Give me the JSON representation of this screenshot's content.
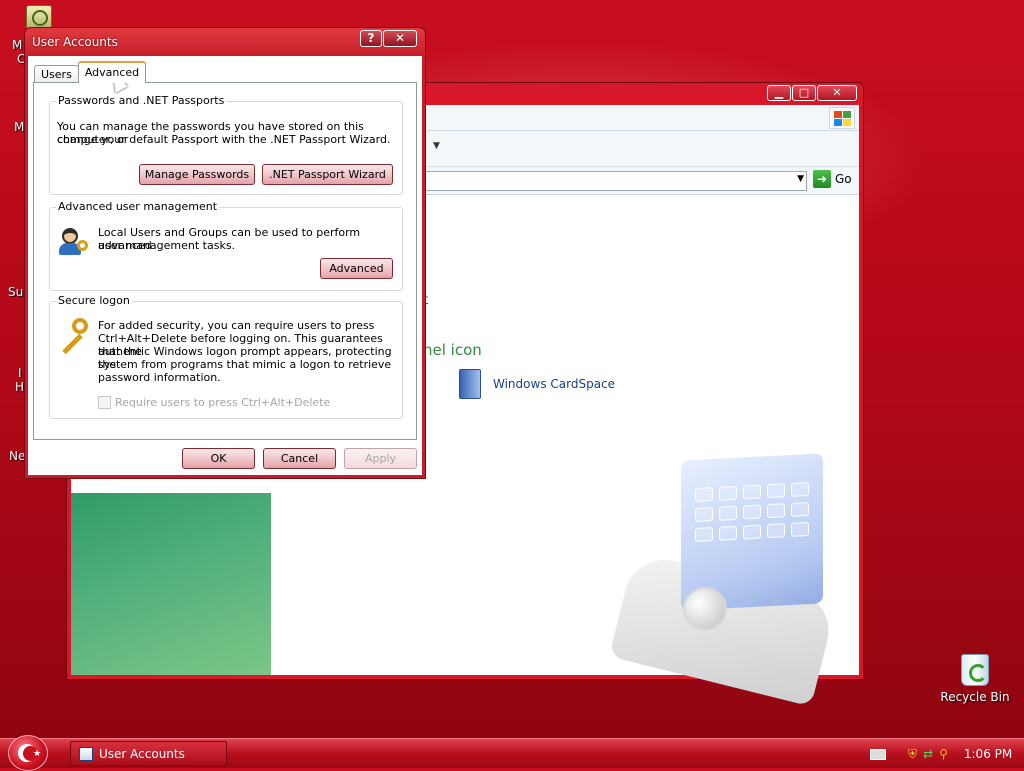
{
  "dialog": {
    "title": "User Accounts",
    "help_glyph": "?",
    "close_glyph": "✕",
    "tabs": [
      {
        "label": "Users",
        "active": false
      },
      {
        "label": "Advanced",
        "active": true
      }
    ],
    "passwords": {
      "title": "Passwords and .NET Passports",
      "text_line1": "You can manage the passwords you have stored on this computer, or",
      "text_line2": "change your default Passport with the .NET Passport Wizard.",
      "manage_button": "Manage Passwords",
      "wizard_button": ".NET Passport Wizard"
    },
    "advanced_management": {
      "title": "Advanced user management",
      "text_line1": "Local Users and Groups can be used to perform advanced",
      "text_line2": "user management tasks.",
      "button": "Advanced"
    },
    "secure_logon": {
      "title": "Secure logon",
      "text_line1": "For added security, you can require users to press",
      "text_line2": "Ctrl+Alt+Delete before logging on. This guarantees that the",
      "text_line3": "authentic Windows logon prompt appears, protecting the",
      "text_line4": "system from programs that mimic a logon to retrieve",
      "text_line5": "password information.",
      "checkbox_label": "Require users to press Ctrl+Alt+Delete",
      "checkbox_checked": false
    },
    "ok_button": "OK",
    "cancel_button": "Cancel",
    "apply_button": "Apply"
  },
  "background_window": {
    "minimize_glyph": "▁",
    "maximize_glyph": "□",
    "close_glyph": "✕",
    "go_label": "Go",
    "go_arrow": "➜",
    "text_fragment_1": "t",
    "text_fragment_2": "nel icon",
    "cardspace_label": "Windows CardSpace"
  },
  "desktop": {
    "fragments": [
      "M",
      "C",
      "M",
      "Su",
      "I",
      "H",
      "Ne"
    ],
    "recycle_bin_label": "Recycle Bin"
  },
  "taskbar": {
    "task_label": "User Accounts",
    "clock": "1:06 PM"
  },
  "colors": {
    "theme_red": "#c41e2a",
    "desktop_red": "#b40818",
    "accent_green": "#2e8b3e"
  }
}
